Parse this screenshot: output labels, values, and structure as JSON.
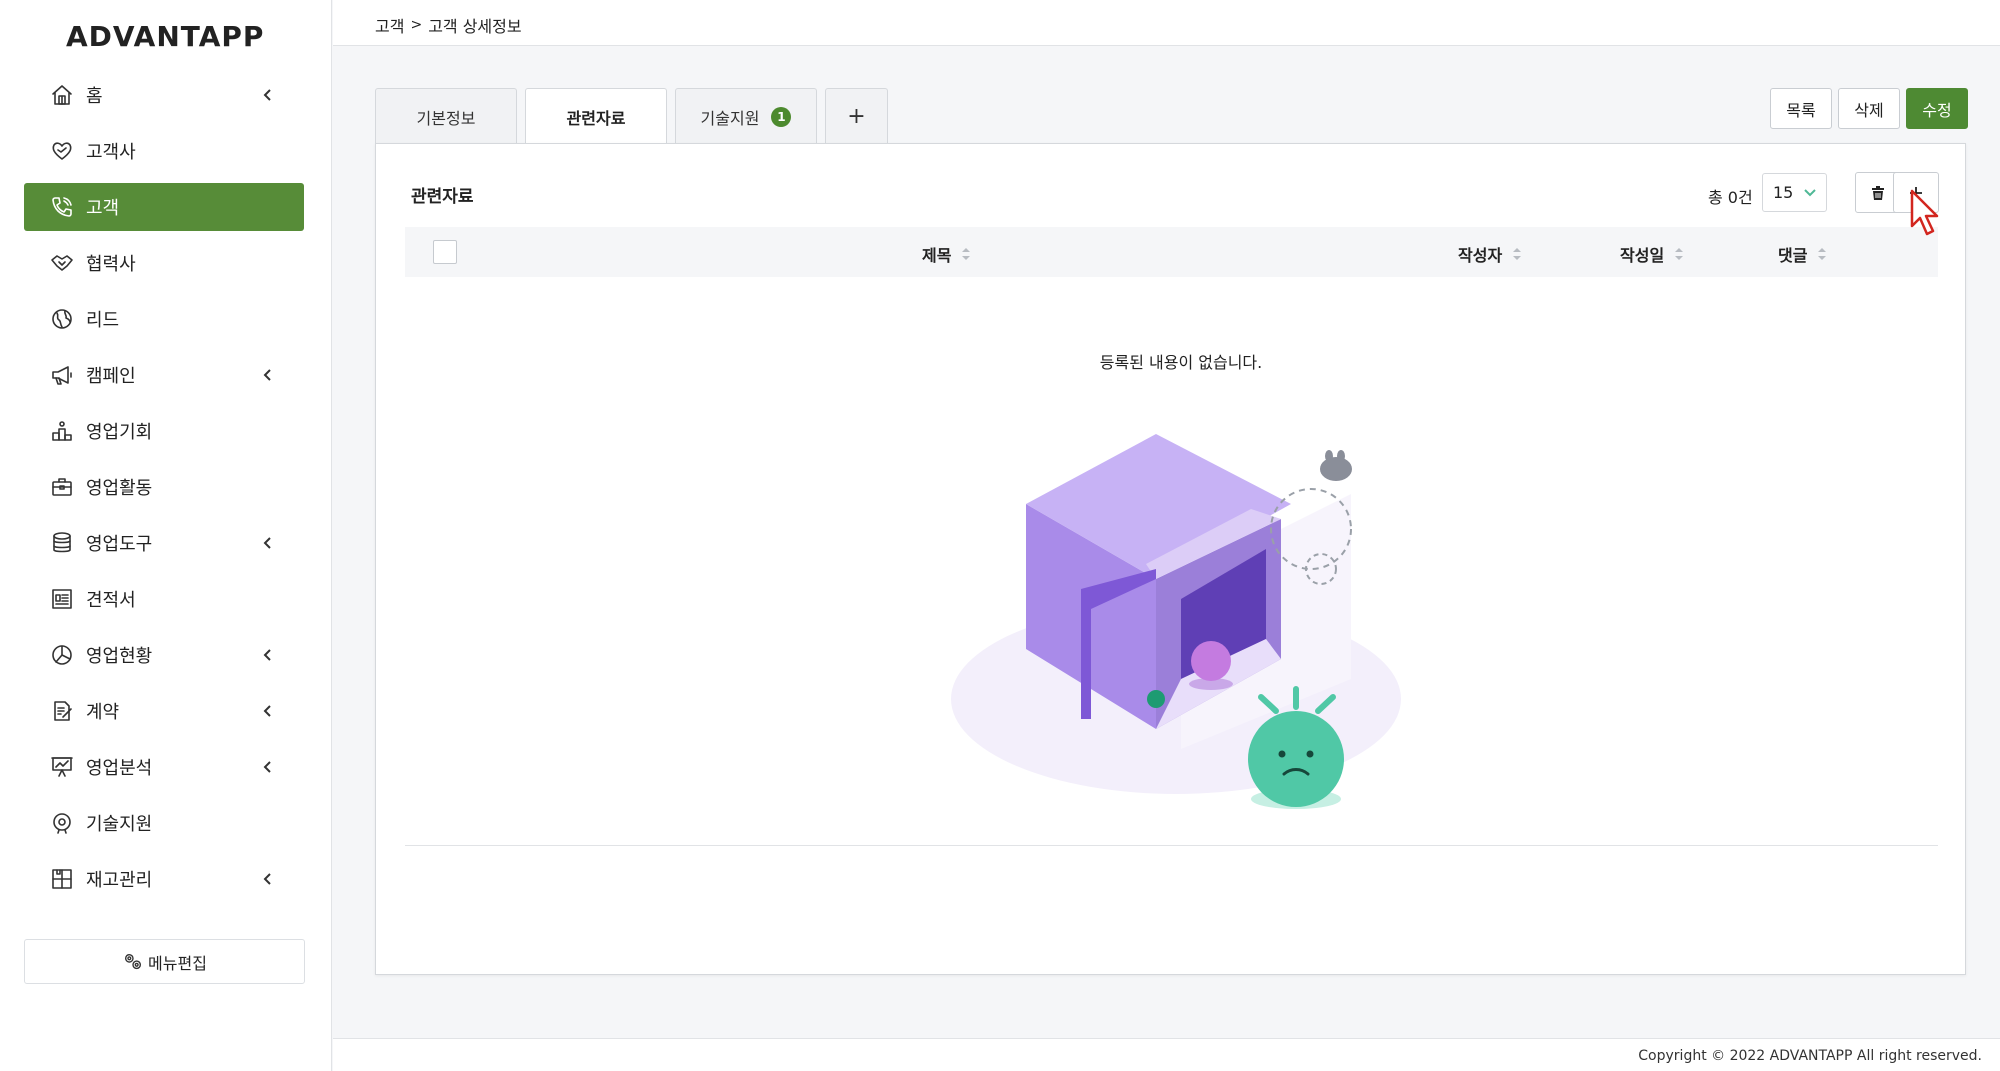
{
  "app": {
    "logo_text": "ADVANTAPP",
    "copyright": "Copyright © 2022 ADVANTAPP All right reserved."
  },
  "sidebar": {
    "items": [
      {
        "label": "홈",
        "icon": "home-icon",
        "has_submenu": true,
        "active": false
      },
      {
        "label": "고객사",
        "icon": "handshake-heart-icon",
        "has_submenu": false,
        "active": false
      },
      {
        "label": "고객",
        "icon": "phone-icon",
        "has_submenu": false,
        "active": true
      },
      {
        "label": "협력사",
        "icon": "handshake-icon",
        "has_submenu": false,
        "active": false
      },
      {
        "label": "리드",
        "icon": "globe-icon",
        "has_submenu": false,
        "active": false
      },
      {
        "label": "캠페인",
        "icon": "megaphone-icon",
        "has_submenu": true,
        "active": false
      },
      {
        "label": "영업기회",
        "icon": "podium-icon",
        "has_submenu": false,
        "active": false
      },
      {
        "label": "영업활동",
        "icon": "briefcase-icon",
        "has_submenu": false,
        "active": false
      },
      {
        "label": "영업도구",
        "icon": "database-icon",
        "has_submenu": true,
        "active": false
      },
      {
        "label": "견적서",
        "icon": "invoice-icon",
        "has_submenu": false,
        "active": false
      },
      {
        "label": "영업현황",
        "icon": "pie-chart-icon",
        "has_submenu": true,
        "active": false
      },
      {
        "label": "계약",
        "icon": "contract-icon",
        "has_submenu": true,
        "active": false
      },
      {
        "label": "영업분석",
        "icon": "presentation-icon",
        "has_submenu": true,
        "active": false
      },
      {
        "label": "기술지원",
        "icon": "support-icon",
        "has_submenu": false,
        "active": false
      },
      {
        "label": "재고관리",
        "icon": "inventory-icon",
        "has_submenu": true,
        "active": false
      }
    ],
    "menu_edit_label": "메뉴편집"
  },
  "header": {
    "breadcrumb": [
      "고객",
      "고객 상세정보"
    ]
  },
  "tabs": [
    {
      "label": "기본정보",
      "active": false
    },
    {
      "label": "관련자료",
      "active": true
    },
    {
      "label": "기술지원",
      "active": false,
      "badge": "1"
    },
    {
      "label": "+",
      "active": false
    }
  ],
  "actions": {
    "list_label": "목록",
    "delete_label": "삭제",
    "edit_label": "수정"
  },
  "panel": {
    "title": "관련자료",
    "total_count": "총 0건",
    "page_size": "15",
    "columns": [
      "제목",
      "작성자",
      "작성일",
      "댓글"
    ],
    "empty_message": "등록된 내용이 없습니다."
  },
  "colors": {
    "accent": "#578c38",
    "badge": "#4d8a2e",
    "select_chevron": "#4fb896"
  }
}
